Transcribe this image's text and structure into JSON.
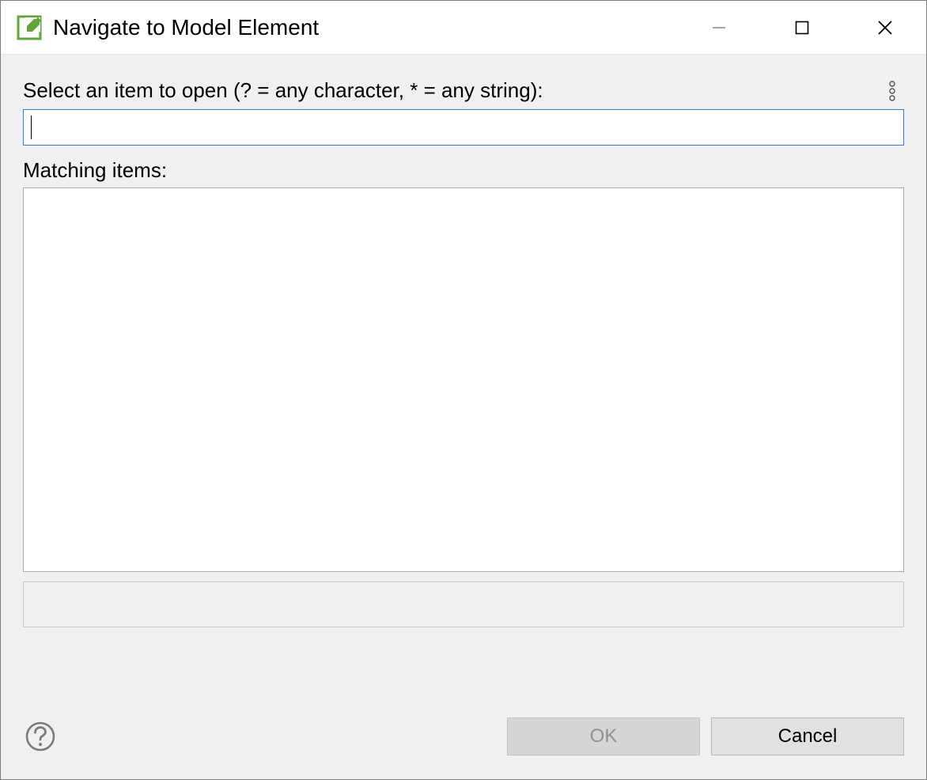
{
  "title": "Navigate to Model Element",
  "labels": {
    "select_prompt": "Select an item to open (? = any character, * = any string):",
    "matching": "Matching items:"
  },
  "search": {
    "value": "",
    "placeholder": ""
  },
  "buttons": {
    "ok": "OK",
    "cancel": "Cancel"
  },
  "icons": {
    "app": "edit-check-icon",
    "minimize": "minimize-icon",
    "maximize": "maximize-icon",
    "close": "close-icon",
    "menu": "kebab-menu-icon",
    "help": "help-icon"
  }
}
